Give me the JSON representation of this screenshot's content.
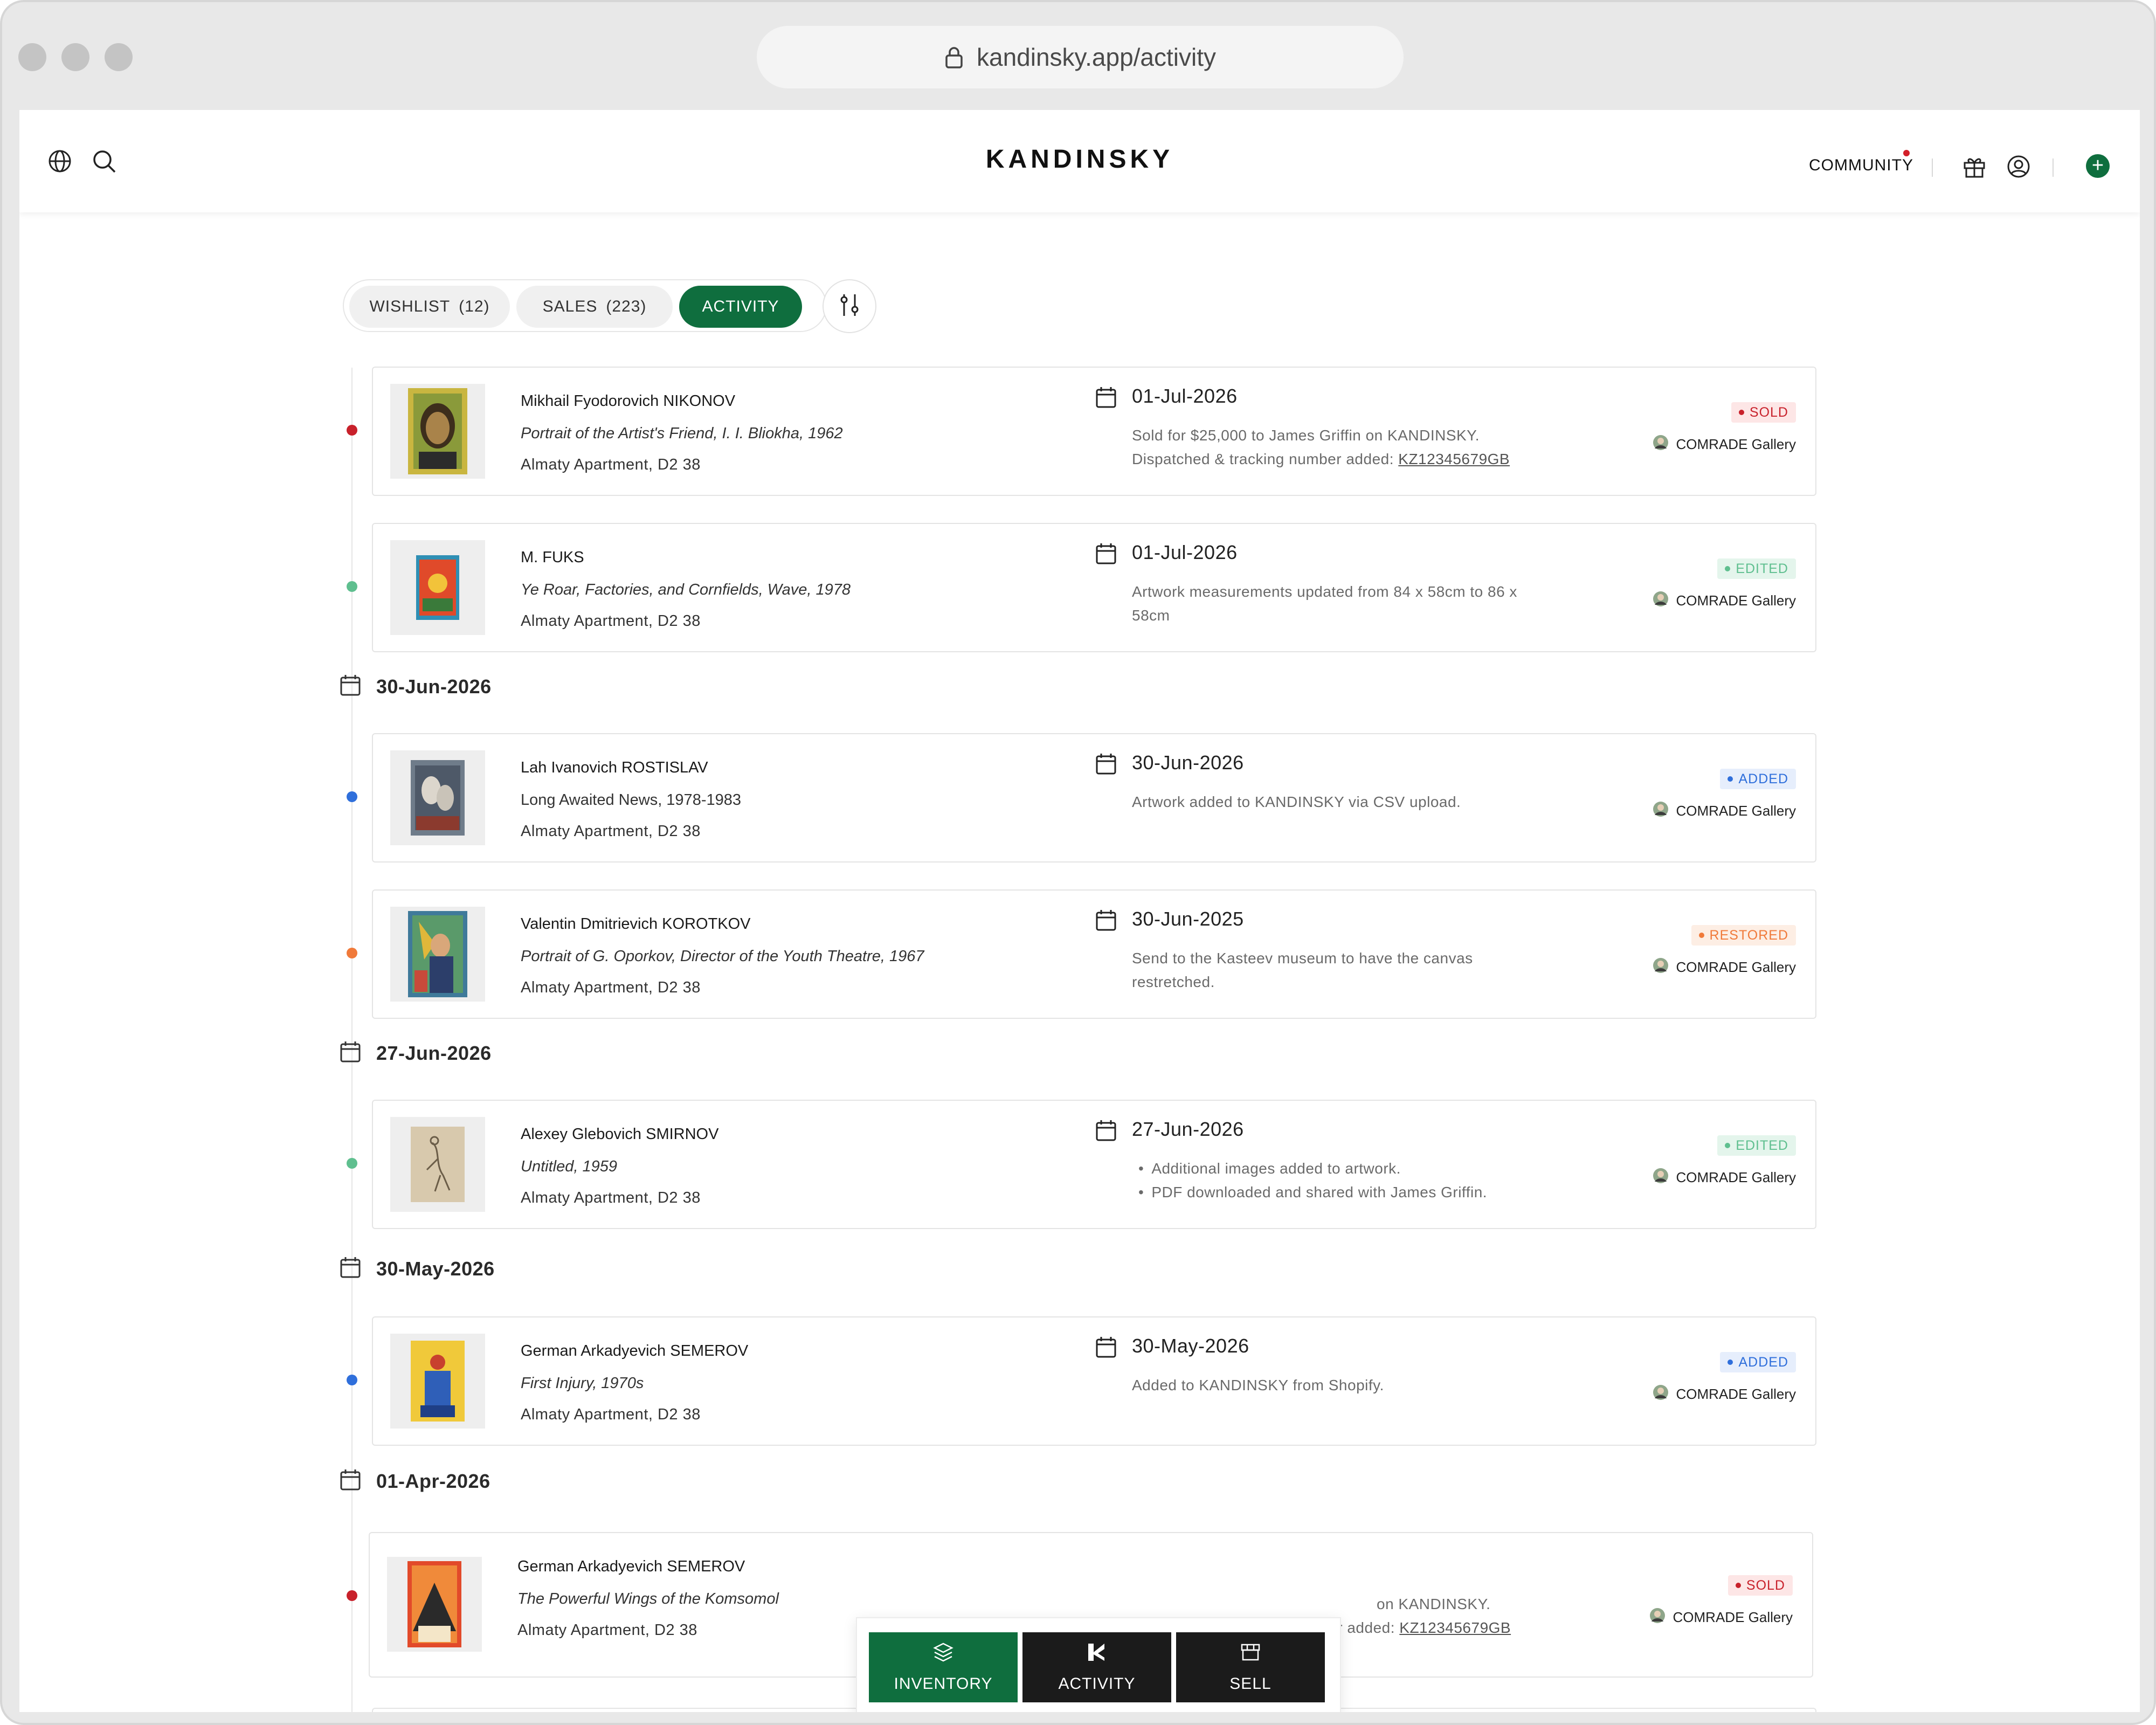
{
  "browser": {
    "url": "kandinsky.app/activity"
  },
  "brand": "KANDINSKY",
  "header": {
    "community_label": "COMMUNITY"
  },
  "tabs": [
    {
      "label": "WISHLIST",
      "count": "(12)"
    },
    {
      "label": "SALES",
      "count": "(223)"
    },
    {
      "label": "ACTIVITY",
      "count": ""
    }
  ],
  "colors": {
    "brand_green": "#0f6e3e",
    "sold": "#c8212b",
    "edited": "#5fbf8f",
    "added": "#2f6fdb",
    "restored": "#f07a3a"
  },
  "groups": [
    {
      "date": "",
      "items": [
        {
          "artist": "Mikhail Fyodorovich NIKONOV",
          "work": "Portrait of the Artist's Friend, I. I. Bliokha, 1962",
          "location": "Almaty Apartment, D2 38",
          "date": "01-Jul-2026",
          "desc": "Sold for $25,000 to James Griffin on KANDINSKY.",
          "desc2": "Dispatched & tracking number added:",
          "tracking": "KZ12345679GB",
          "status": "SOLD",
          "gallery": "COMRADE Gallery"
        },
        {
          "artist": "M. FUKS",
          "work": "Ye Roar, Factories, and Cornfields, Wave, 1978",
          "location": "Almaty Apartment, D2 38",
          "date": "01-Jul-2026",
          "desc": "Artwork measurements updated from 84 x 58cm to 86 x 58cm",
          "status": "EDITED",
          "gallery": "COMRADE Gallery"
        }
      ]
    },
    {
      "date": "30-Jun-2026",
      "items": [
        {
          "artist": "Lah Ivanovich ROSTISLAV",
          "work": "Long Awaited News, 1978-1983",
          "location": "Almaty Apartment, D2 38",
          "date": "30-Jun-2026",
          "desc": "Artwork added to KANDINSKY via CSV upload.",
          "status": "ADDED",
          "gallery": "COMRADE Gallery"
        },
        {
          "artist": "Valentin Dmitrievich KOROTKOV",
          "work": "Portrait of G. Oporkov, Director of the Youth Theatre, 1967",
          "location": "Almaty Apartment, D2 38",
          "date": "30-Jun-2025",
          "desc": "Send to the Kasteev museum to have the canvas restretched.",
          "status": "RESTORED",
          "gallery": "COMRADE Gallery"
        }
      ]
    },
    {
      "date": "27-Jun-2026",
      "items": [
        {
          "artist": "Alexey Glebovich SMIRNOV",
          "work": "Untitled, 1959",
          "location": "Almaty Apartment, D2 38",
          "date": "27-Jun-2026",
          "bullets": [
            "Additional images added to artwork.",
            "PDF downloaded and shared with James Griffin."
          ],
          "status": "EDITED",
          "gallery": "COMRADE Gallery"
        }
      ]
    },
    {
      "date": "30-May-2026",
      "items": [
        {
          "artist": "German Arkadyevich SEMEROV",
          "work": "First Injury, 1970s",
          "location": "Almaty Apartment, D2 38",
          "date": "30-May-2026",
          "desc": "Added to KANDINSKY from Shopify.",
          "status": "ADDED",
          "gallery": "COMRADE Gallery"
        }
      ]
    },
    {
      "date": "01-Apr-2026",
      "items": [
        {
          "artist": "German Arkadyevich SEMEROV",
          "work": "The Powerful Wings of the Komsomol",
          "location": "Almaty Apartment, D2 38",
          "date": "",
          "desc": "on KANDINSKY.",
          "desc2": "Dispatched & tracking number added:",
          "tracking": "KZ12345679GB",
          "status": "SOLD",
          "gallery": "COMRADE Gallery"
        }
      ]
    }
  ],
  "bottom_nav": [
    {
      "label": "INVENTORY",
      "icon": "layers-icon"
    },
    {
      "label": "ACTIVITY",
      "icon": "kandinsky-k-icon"
    },
    {
      "label": "SELL",
      "icon": "store-icon"
    }
  ]
}
